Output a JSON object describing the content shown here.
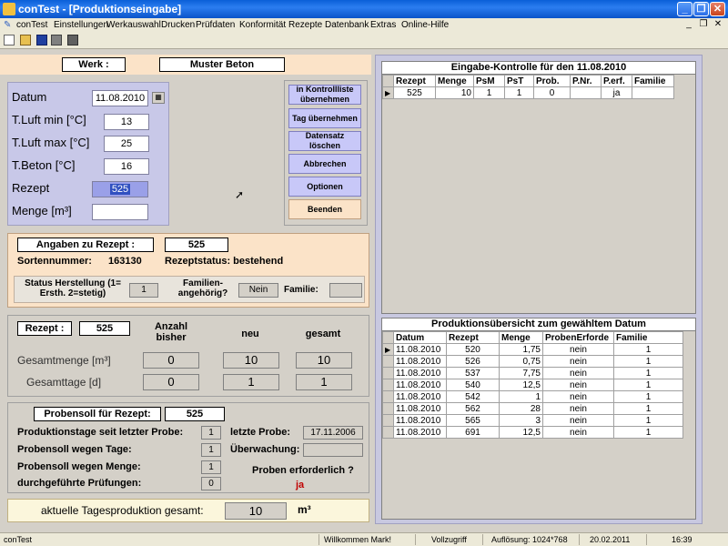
{
  "window": {
    "title": "conTest - [Produktionseingabe]"
  },
  "menu": [
    "conTest",
    "Einstellungen",
    "Werkauswahl",
    "Drucken",
    "Prüfdaten",
    "Konformität",
    "Rezepte",
    "Datenbank",
    "Extras",
    "Online-Hilfe"
  ],
  "werk": {
    "label": "Werk :",
    "value": "Muster Beton"
  },
  "input": {
    "datum_label": "Datum",
    "datum": "11.08.2010",
    "tluft_min_label": "T.Luft min [°C]",
    "tluft_min": "13",
    "tluft_max_label": "T.Luft max [°C]",
    "tluft_max": "25",
    "tbeton_label": "T.Beton [°C]",
    "tbeton": "16",
    "rezept_label": "Rezept",
    "rezept": "525",
    "menge_label": "Menge [m³]",
    "menge": ""
  },
  "buttons": {
    "kontrollliste": "in Kontrollliste übernehmen",
    "tag": "Tag übernehmen",
    "loeschen": "Datensatz löschen",
    "abbrechen": "Abbrechen",
    "optionen": "Optionen",
    "beenden": "Beenden"
  },
  "angaben": {
    "label": "Angaben zu Rezept :",
    "rezept": "525",
    "sortennummer_label": "Sortennummer:",
    "sortennummer": "163130",
    "status_label": "Rezeptstatus: bestehend",
    "herstellung_label": "Status Herstellung (1= Ersth.  2=stetig)",
    "herstellung": "1",
    "familien_label": "Familien- angehörig?",
    "familien": "Nein",
    "familie_label": "Familie:",
    "familie": ""
  },
  "mengen": {
    "rezept_label": "Rezept :",
    "rezept": "525",
    "col_bisher": "Anzahl bisher",
    "col_neu": "neu",
    "col_gesamt": "gesamt",
    "gesamtmenge_label": "Gesamtmenge [m³]",
    "gm_bisher": "0",
    "gm_neu": "10",
    "gm_gesamt": "10",
    "gesamttage_label": "Gesamttage [d]",
    "gt_bisher": "0",
    "gt_neu": "1",
    "gt_gesamt": "1"
  },
  "probensoll": {
    "label": "Probensoll für Rezept:",
    "rezept": "525",
    "tage_seit_label": "Produktionstage seit letzter Probe:",
    "tage_seit": "1",
    "letzte_label": "letzte Probe:",
    "letzte": "17.11.2006",
    "wegen_tage_label": "Probensoll wegen Tage:",
    "wegen_tage": "1",
    "ueberwachung_label": "Überwachung:",
    "ueberwachung": "",
    "wegen_menge_label": "Probensoll wegen Menge:",
    "wegen_menge": "1",
    "durchgefuehrt_label": "durchgeführte Prüfungen:",
    "durchgefuehrt": "0",
    "erforderlich_label": "Proben erforderlich ?",
    "erforderlich": "ja"
  },
  "tagesproduktion": {
    "label": "aktuelle Tagesproduktion gesamt:",
    "value": "10",
    "unit": "m³"
  },
  "kontrolle": {
    "title": "Eingabe-Kontrolle für den 11.08.2010",
    "headers": [
      "Rezept",
      "Menge",
      "PsM",
      "PsT",
      "Prob.",
      "P.Nr.",
      "P.erf.",
      "Familie"
    ],
    "rows": [
      [
        "525",
        "10",
        "1",
        "1",
        "0",
        "",
        "ja",
        ""
      ]
    ]
  },
  "uebersicht": {
    "title": "Produktionsübersicht zum gewähltem Datum",
    "headers": [
      "Datum",
      "Rezept",
      "Menge",
      "ProbenErforde",
      "Familie"
    ],
    "rows": [
      [
        "11.08.2010",
        "520",
        "1,75",
        "nein",
        "1"
      ],
      [
        "11.08.2010",
        "526",
        "0,75",
        "nein",
        "1"
      ],
      [
        "11.08.2010",
        "537",
        "7,75",
        "nein",
        "1"
      ],
      [
        "11.08.2010",
        "540",
        "12,5",
        "nein",
        "1"
      ],
      [
        "11.08.2010",
        "542",
        "1",
        "nein",
        "1"
      ],
      [
        "11.08.2010",
        "562",
        "28",
        "nein",
        "1"
      ],
      [
        "11.08.2010",
        "565",
        "3",
        "nein",
        "1"
      ],
      [
        "11.08.2010",
        "691",
        "12,5",
        "nein",
        "1"
      ]
    ]
  },
  "status": {
    "app": "conTest",
    "welcome": "Willkommen Mark!",
    "access": "Vollzugriff",
    "resolution": "Auflösung: 1024*768",
    "date": "20.02.2011",
    "time": "16:39"
  }
}
